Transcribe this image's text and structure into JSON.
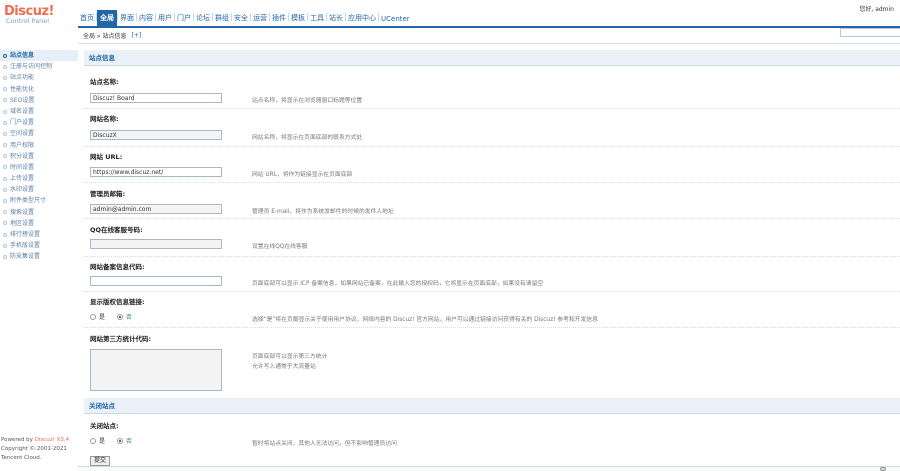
{
  "logo": {
    "brand": "Discuz",
    "excl": "!",
    "subtitle": "Control Panel"
  },
  "topnav": {
    "items": [
      "首页",
      "全局",
      "界面",
      "内容",
      "用户",
      "门户",
      "论坛",
      "群组",
      "安全",
      "运营",
      "插件",
      "模板",
      "工具",
      "站长",
      "应用中心",
      "UCenter"
    ],
    "active_index": 1
  },
  "userbox": "您好, admin",
  "breadcrumb": {
    "path": "全局 » 站点信息",
    "plus": "[+]"
  },
  "sidebar": {
    "items": [
      "站点信息",
      "注册与访问控制",
      "站点功能",
      "性能优化",
      "SEO设置",
      "域名设置",
      "门户设置",
      "空间设置",
      "用户权限",
      "积分设置",
      "时间设置",
      "上传设置",
      "水印设置",
      "附件类型尺寸",
      "搜索设置",
      "地区设置",
      "排行榜设置",
      "手机版设置",
      "防采集设置"
    ],
    "active_index": 0
  },
  "footer": {
    "powered_prefix": "Powered by ",
    "powered_brand": "Discuz! X3.4",
    "copyright": "Copyright © 2001-2021",
    "company": "Tencent Cloud."
  },
  "main": {
    "section1": "站点信息",
    "fields": [
      {
        "label": "站点名称:",
        "value": "Discuz! Board",
        "desc": "站点名称，将显示在浏览器窗口标题等位置"
      },
      {
        "label": "网站名称:",
        "value": "DiscuzX",
        "desc": "网站名称，将显示在页面底部的联系方式处"
      },
      {
        "label": "网站 URL:",
        "value": "https://www.discuz.net/",
        "desc": "网站 URL，将作为链接显示在页面底部"
      },
      {
        "label": "管理员邮箱:",
        "value": "admin@admin.com",
        "desc": "管理员 E-mail，将作为系统发邮件的时候的发件人地址"
      },
      {
        "label": "QQ在线客服号码:",
        "value": "",
        "desc": "设置在线QQ在线客服"
      },
      {
        "label": "网站备案信息代码:",
        "value": "",
        "desc": "页面底部可以显示 ICP 备案信息，如果网站已备案，在此输入您的授权码，它将显示在页面底部，如果没有请留空"
      }
    ],
    "radio_field": {
      "label": "显示版权信息链接:",
      "yes": "是",
      "no": "否",
      "desc": "选择“是”将在页脚显示关于使用用户协议，网络内容的 Discuz! 官方网站，用户可以通过链接访问获得有关的 Discuz! 参考和开发信息"
    },
    "textarea_field": {
      "label": "网站第三方统计代码:",
      "desc1": "页面底部可以显示第三方统计",
      "desc2": "允许写入通常于大流量站"
    },
    "section2": "关闭站点",
    "close_field": {
      "label": "关闭站点:",
      "yes": "是",
      "no": "否",
      "desc": "暂时将站点关闭，其他人无法访问，但不影响管理员访问"
    },
    "submit": "提交"
  }
}
